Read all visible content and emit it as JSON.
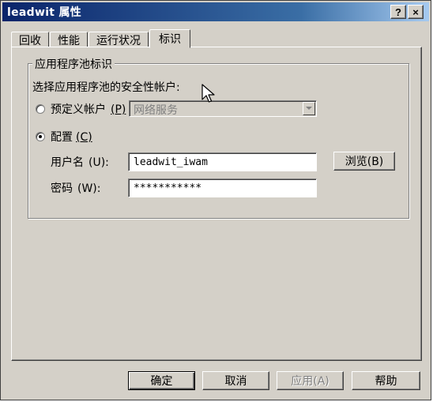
{
  "window": {
    "title": "leadwit 属性",
    "help_label": "?",
    "close_label": "×"
  },
  "tabs": [
    {
      "label": "回收",
      "active": false
    },
    {
      "label": "性能",
      "active": false
    },
    {
      "label": "运行状况",
      "active": false
    },
    {
      "label": "标识",
      "active": true
    }
  ],
  "identity": {
    "group_title": "应用程序池标识",
    "prompt": "选择应用程序池的安全性帐户:",
    "predefined": {
      "label": "预定义帐户",
      "accel": "(P)",
      "selected": false,
      "combo_value": "网络服务"
    },
    "configurable": {
      "label": "配置",
      "accel": "(C)",
      "selected": true
    },
    "username": {
      "label": "用户名",
      "accel": "(U):",
      "value": "leadwit_iwam"
    },
    "password": {
      "label": "密码",
      "accel": "(W):",
      "value": "***********"
    },
    "browse_label": "浏览(B)"
  },
  "footer": {
    "ok_label": "确定",
    "cancel_label": "取消",
    "apply_label": "应用(A)",
    "help_label": "帮助"
  }
}
